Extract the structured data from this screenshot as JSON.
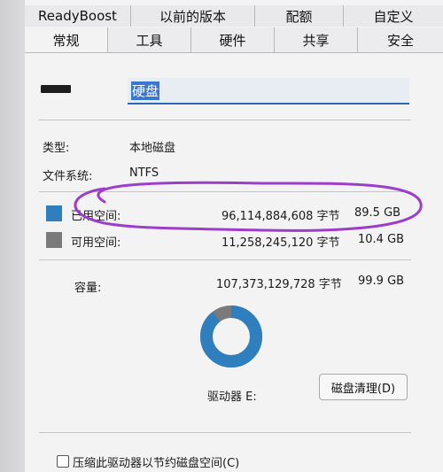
{
  "tabs_top": [
    "ReadyBoost",
    "以前的版本",
    "配额",
    "自定义"
  ],
  "tabs_bottom": [
    "常规",
    "工具",
    "硬件",
    "共享",
    "安全"
  ],
  "drive_name": "硬盘",
  "type_label": "类型:",
  "type_value": "本地磁盘",
  "fs_label": "文件系统:",
  "fs_value": "NTFS",
  "used": {
    "label": "已用空间:",
    "bytes": "96,114,884,608 字节",
    "size": "89.5 GB",
    "color": "#2f7fbf"
  },
  "free": {
    "label": "可用空间:",
    "bytes": "11,258,245,120 字节",
    "size": "10.4 GB",
    "color": "#7a7a7a"
  },
  "capacity": {
    "label": "容量:",
    "bytes": "107,373,129,728 字节",
    "size": "99.9 GB"
  },
  "used_fraction": 0.895,
  "drive_label": "驱动器 E:",
  "cleanup_button": "磁盘清理(D)",
  "compress_label": "压缩此驱动器以节约磁盘空间(C)"
}
